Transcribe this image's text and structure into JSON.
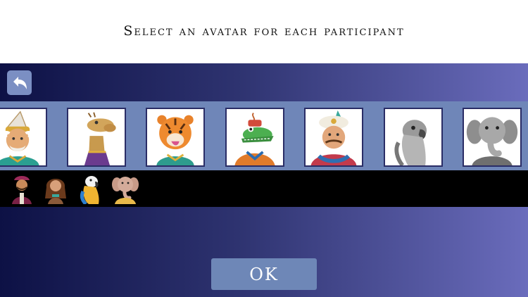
{
  "header": {
    "title": "Select an avatar for each participant"
  },
  "toolbar": {
    "back_icon": "back-arrow-icon"
  },
  "avatars": [
    {
      "name": "sultan-avatar",
      "state": "available"
    },
    {
      "name": "camel-avatar",
      "state": "available"
    },
    {
      "name": "tiger-avatar",
      "state": "available"
    },
    {
      "name": "crocodile-avatar",
      "state": "available"
    },
    {
      "name": "turbaned-man-avatar",
      "state": "available"
    },
    {
      "name": "parrot-avatar",
      "state": "taken"
    },
    {
      "name": "elephant-avatar",
      "state": "taken"
    }
  ],
  "selected_avatars": [
    {
      "name": "aladdin-avatar"
    },
    {
      "name": "princess-avatar"
    },
    {
      "name": "parrot-avatar"
    },
    {
      "name": "elephant-avatar"
    }
  ],
  "footer": {
    "ok_label": "OK"
  },
  "colors": {
    "gradient_start": "#0d1145",
    "gradient_end": "#6a6cbc",
    "strip": "#6f86b8",
    "button": "#6e87b7",
    "chosen_bar": "#000000"
  }
}
